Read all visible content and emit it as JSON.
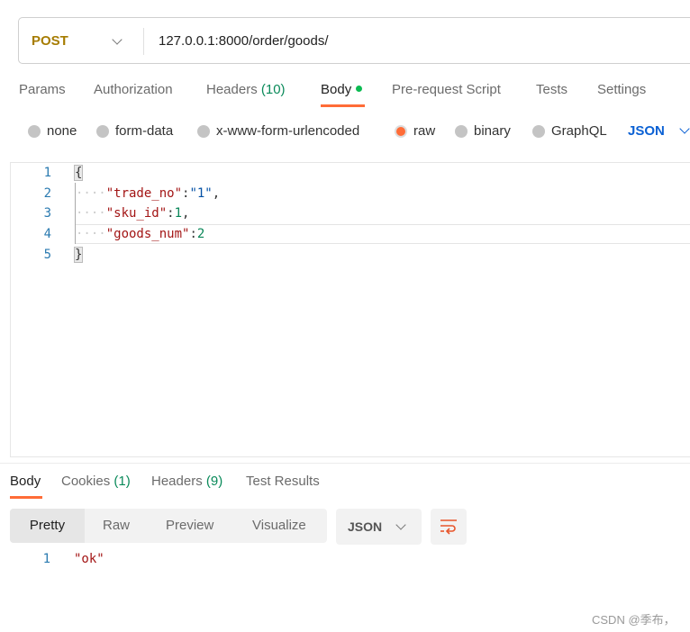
{
  "request": {
    "method": "POST",
    "url": "127.0.0.1:8000/order/goods/"
  },
  "tabs": [
    {
      "label": "Params"
    },
    {
      "label": "Authorization"
    },
    {
      "label": "Headers",
      "count": "(10)"
    },
    {
      "label": "Body"
    },
    {
      "label": "Pre-request Script"
    },
    {
      "label": "Tests"
    },
    {
      "label": "Settings"
    }
  ],
  "body_types": [
    "none",
    "form-data",
    "x-www-form-urlencoded",
    "raw",
    "binary",
    "GraphQL"
  ],
  "body_type_selected": "raw",
  "body_format": "JSON",
  "editor": {
    "line_numbers": [
      "1",
      "2",
      "3",
      "4",
      "5"
    ],
    "open": "{",
    "close": "}",
    "indent": "····",
    "fields": [
      {
        "key": "\"trade_no\"",
        "value": "\"1\"",
        "sep": ":",
        "end": ","
      },
      {
        "key": "\"sku_id\"",
        "value": "1",
        "sep": ":",
        "end": ","
      },
      {
        "key": "\"goods_num\"",
        "value": "2",
        "sep": ":",
        "end": ""
      }
    ]
  },
  "response": {
    "tabs": [
      {
        "label": "Body"
      },
      {
        "label": "Cookies",
        "count": "(1)"
      },
      {
        "label": "Headers",
        "count": "(9)"
      },
      {
        "label": "Test Results"
      }
    ],
    "views": [
      "Pretty",
      "Raw",
      "Preview",
      "Visualize"
    ],
    "format": "JSON",
    "lines": [
      {
        "n": "1",
        "text": "\"ok\""
      }
    ]
  },
  "watermark": "CSDN @季布，",
  "colors": {
    "accent": "#ff6c37",
    "method": "#a67c00",
    "status_dot": "#0cbb52",
    "link": "#0b61d4"
  }
}
